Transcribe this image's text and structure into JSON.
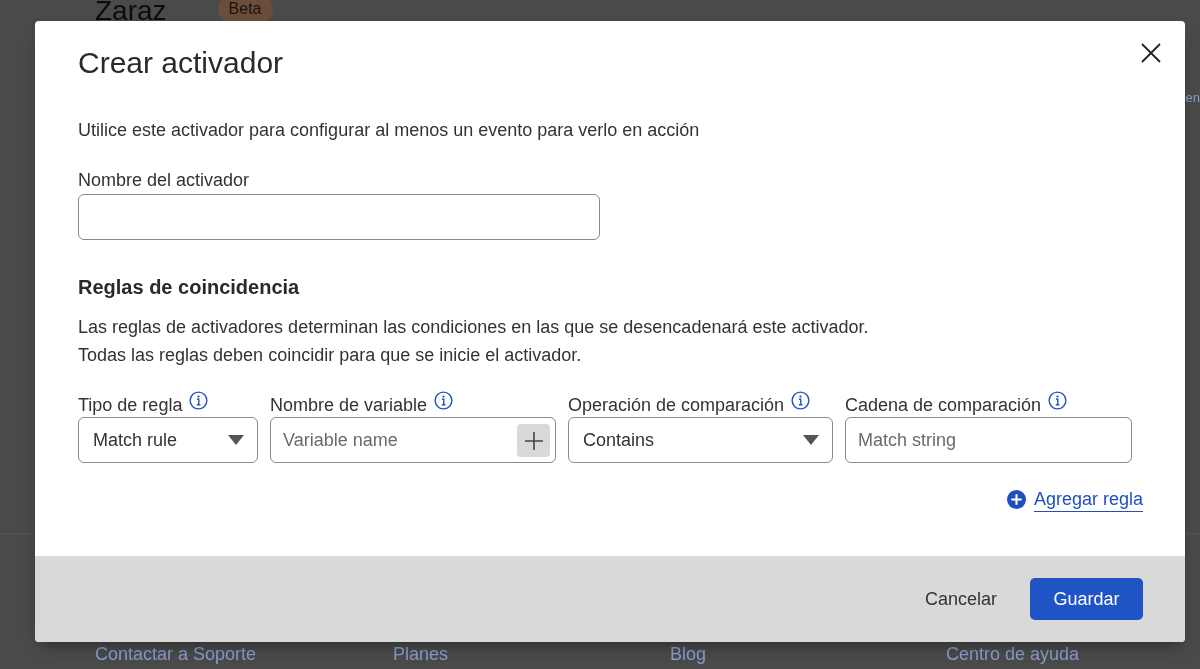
{
  "background_page": {
    "title": "Zaraz",
    "badge": "Beta",
    "edge_text": "en",
    "footer_links": [
      "Contactar a Soporte",
      "Planes",
      "Blog",
      "Centro de ayuda"
    ]
  },
  "dialog": {
    "title": "Crear activador",
    "description": "Utilice este activador para configurar al menos un evento para verlo en acción",
    "name_field": {
      "label": "Nombre del activador"
    },
    "rules_section": {
      "heading": "Reglas de coincidencia",
      "description": "Las reglas de activadores determinan las condiciones en las que se desencadenará este activador.\nTodas las reglas deben coincidir para que se inicie el activador.",
      "rule_fields": [
        {
          "kind": "select",
          "label": "Tipo de regla",
          "value": "Match rule"
        },
        {
          "kind": "input_with_add",
          "label": "Nombre de variable",
          "placeholder": "Variable name"
        },
        {
          "kind": "select",
          "label": "Operación de comparación",
          "value": "Contains"
        },
        {
          "kind": "input",
          "label": "Cadena de comparación",
          "placeholder": "Match string"
        }
      ],
      "add_rule_link": "Agregar regla"
    },
    "buttons": [
      {
        "kind": "secondary",
        "label": "Cancelar"
      },
      {
        "kind": "primary",
        "label": "Guardar"
      }
    ]
  }
}
